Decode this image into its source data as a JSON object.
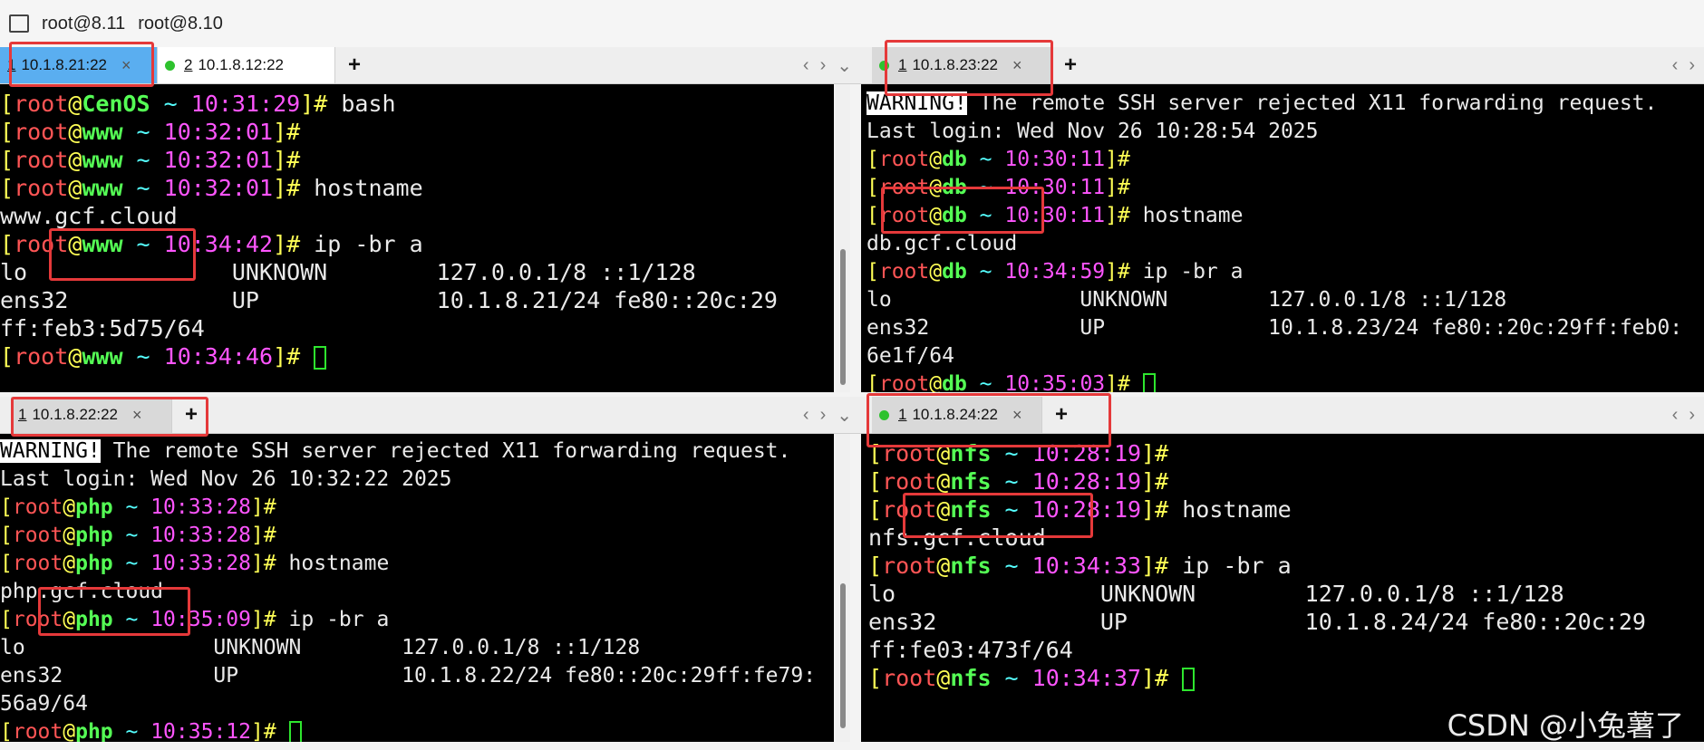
{
  "titlebar": {
    "session1": "root@8.11",
    "session2": "root@8.10"
  },
  "panes": {
    "tl": {
      "tabs": [
        {
          "index": "1",
          "label": "10.1.8.21:22"
        },
        {
          "index": "2",
          "label": "10.1.8.12:22"
        }
      ],
      "lines": [
        {
          "type": "prompt",
          "host": "CenOS",
          "time": "10:31:29",
          "cmd": " bash"
        },
        {
          "type": "prompt",
          "host": "www",
          "time": "10:32:01",
          "cmd": ""
        },
        {
          "type": "prompt",
          "host": "www",
          "time": "10:32:01",
          "cmd": ""
        },
        {
          "type": "prompt",
          "host": "www",
          "time": "10:32:01",
          "cmd": " hostname"
        },
        {
          "type": "text",
          "text": "www.gcf.cloud"
        },
        {
          "type": "prompt",
          "host": "www",
          "time": "10:34:42",
          "cmd": " ip -br a"
        },
        {
          "type": "text",
          "text": "lo               UNKNOWN        127.0.0.1/8 ::1/128"
        },
        {
          "type": "text",
          "text": "ens32            UP             10.1.8.21/24 fe80::20c:29"
        },
        {
          "type": "text",
          "text": "ff:feb3:5d75/64"
        },
        {
          "type": "prompt",
          "host": "www",
          "time": "10:34:46",
          "cmd": " ",
          "cursor": true
        }
      ]
    },
    "tr": {
      "tabs": [
        {
          "index": "1",
          "label": "10.1.8.23:22"
        }
      ],
      "lines": [
        {
          "type": "warn",
          "warn": "WARNING!",
          "text": " The remote SSH server rejected X11 forwarding request."
        },
        {
          "type": "text",
          "text": "Last login: Wed Nov 26 10:28:54 2025"
        },
        {
          "type": "prompt",
          "host": "db",
          "time": "10:30:11",
          "cmd": ""
        },
        {
          "type": "prompt",
          "host": "db",
          "time": "10:30:11",
          "cmd": ""
        },
        {
          "type": "prompt",
          "host": "db",
          "time": "10:30:11",
          "cmd": " hostname"
        },
        {
          "type": "text",
          "text": "db.gcf.cloud"
        },
        {
          "type": "prompt",
          "host": "db",
          "time": "10:34:59",
          "cmd": " ip -br a"
        },
        {
          "type": "text",
          "text": "lo               UNKNOWN        127.0.0.1/8 ::1/128"
        },
        {
          "type": "text",
          "text": "ens32            UP             10.1.8.23/24 fe80::20c:29ff:feb0:"
        },
        {
          "type": "text",
          "text": "6e1f/64"
        },
        {
          "type": "prompt",
          "host": "db",
          "time": "10:35:03",
          "cmd": " ",
          "cursor": true
        }
      ]
    },
    "bl": {
      "tabs": [
        {
          "index": "1",
          "label": "10.1.8.22:22"
        }
      ],
      "lines": [
        {
          "type": "warn",
          "warn": "WARNING!",
          "text": " The remote SSH server rejected X11 forwarding request."
        },
        {
          "type": "text",
          "text": "Last login: Wed Nov 26 10:32:22 2025"
        },
        {
          "type": "prompt",
          "host": "php",
          "time": "10:33:28",
          "cmd": ""
        },
        {
          "type": "prompt",
          "host": "php",
          "time": "10:33:28",
          "cmd": ""
        },
        {
          "type": "prompt",
          "host": "php",
          "time": "10:33:28",
          "cmd": " hostname"
        },
        {
          "type": "text",
          "text": "php.gcf.cloud"
        },
        {
          "type": "prompt",
          "host": "php",
          "time": "10:35:09",
          "cmd": " ip -br a"
        },
        {
          "type": "text",
          "text": "lo               UNKNOWN        127.0.0.1/8 ::1/128"
        },
        {
          "type": "text",
          "text": "ens32            UP             10.1.8.22/24 fe80::20c:29ff:fe79:"
        },
        {
          "type": "text",
          "text": "56a9/64"
        },
        {
          "type": "prompt",
          "host": "php",
          "time": "10:35:12",
          "cmd": " ",
          "cursor": true
        }
      ]
    },
    "br": {
      "tabs": [
        {
          "index": "1",
          "label": "10.1.8.24:22"
        }
      ],
      "lines": [
        {
          "type": "prompt",
          "host": "nfs",
          "time": "10:28:19",
          "cmd": ""
        },
        {
          "type": "prompt",
          "host": "nfs",
          "time": "10:28:19",
          "cmd": ""
        },
        {
          "type": "prompt",
          "host": "nfs",
          "time": "10:28:19",
          "cmd": " hostname"
        },
        {
          "type": "text",
          "text": "nfs.gcf.cloud"
        },
        {
          "type": "prompt",
          "host": "nfs",
          "time": "10:34:33",
          "cmd": " ip -br a"
        },
        {
          "type": "text",
          "text": "lo               UNKNOWN        127.0.0.1/8 ::1/128"
        },
        {
          "type": "text",
          "text": "ens32            UP             10.1.8.24/24 fe80::20c:29"
        },
        {
          "type": "text",
          "text": "ff:fe03:473f/64"
        },
        {
          "type": "prompt",
          "host": "nfs",
          "time": "10:34:37",
          "cmd": " ",
          "cursor": true
        }
      ]
    }
  },
  "prompt": {
    "open": "[",
    "user": "root",
    "at": "@",
    "tilde": " ~ ",
    "close": "]#"
  },
  "watermark": "CSDN @小兔薯了",
  "colors": {
    "active_tab": "#5aaef0",
    "highlight_box": "#e5393a",
    "host": "#55ff55",
    "user": "#ff5555",
    "time": "#ff55ff"
  }
}
